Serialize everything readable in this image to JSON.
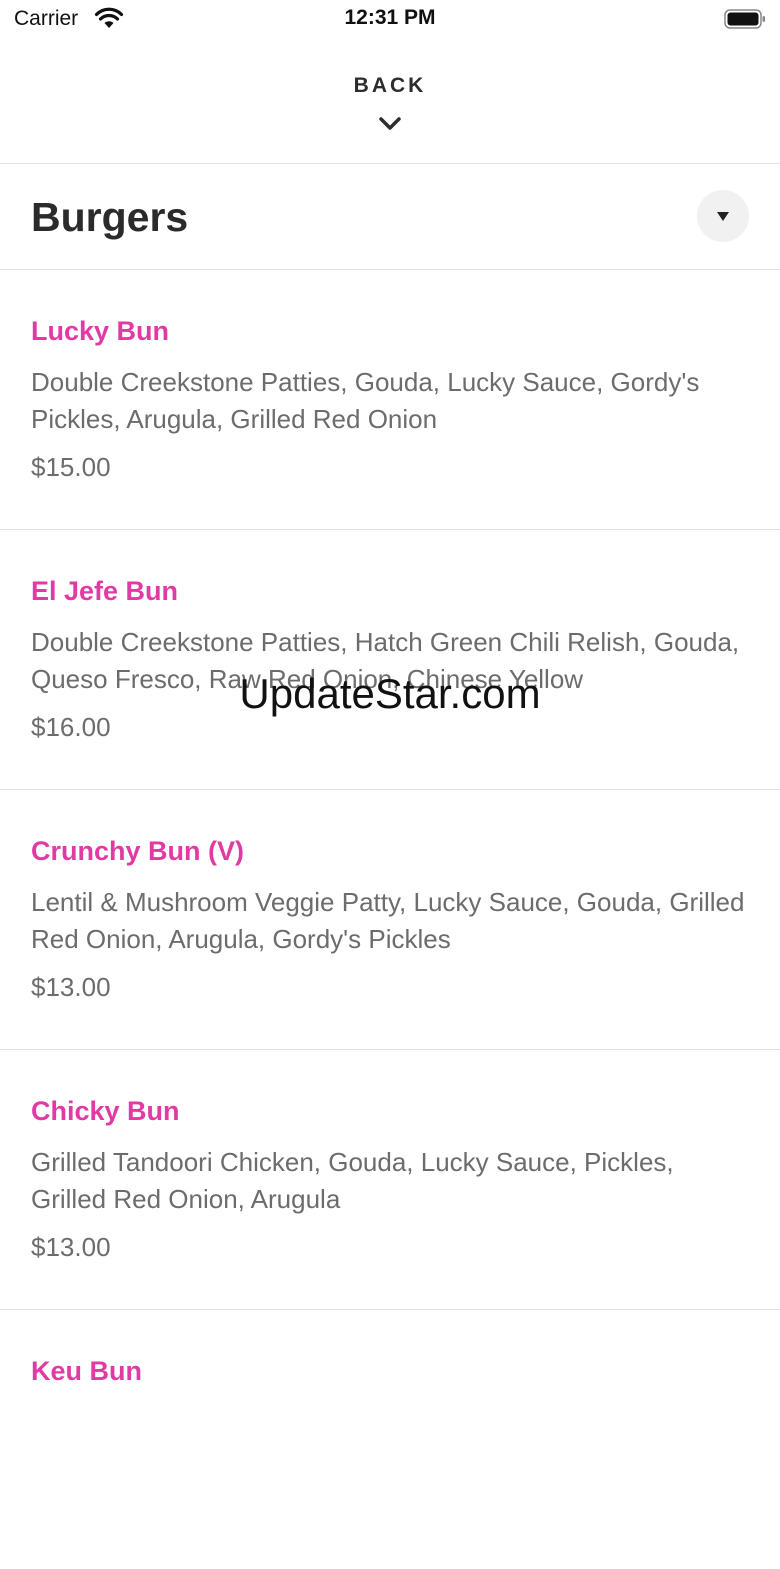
{
  "status_bar": {
    "carrier": "Carrier",
    "time": "12:31 PM"
  },
  "nav": {
    "back_label": "BACK"
  },
  "section": {
    "title": "Burgers"
  },
  "items": [
    {
      "name": "Lucky Bun",
      "description": "Double Creekstone Patties, Gouda, Lucky Sauce, Gordy's Pickles, Arugula, Grilled Red Onion",
      "price": "$15.00"
    },
    {
      "name": "El Jefe Bun",
      "description": "Double Creekstone Patties, Hatch Green Chili Relish, Gouda, Queso Fresco, Raw Red Onion, Chinese Yellow",
      "price": "$16.00"
    },
    {
      "name": "Crunchy Bun (V)",
      "description": "Lentil & Mushroom Veggie Patty, Lucky Sauce, Gouda, Grilled Red Onion, Arugula, Gordy's Pickles",
      "price": "$13.00"
    },
    {
      "name": "Chicky Bun",
      "description": "Grilled Tandoori Chicken, Gouda, Lucky Sauce, Pickles, Grilled Red Onion, Arugula",
      "price": "$13.00"
    },
    {
      "name": "Keu Bun",
      "description": "",
      "price": ""
    }
  ],
  "watermark": "UpdateStar.com",
  "colors": {
    "accent": "#e23aa4",
    "text_muted": "#6c6c6c",
    "divider": "#e2e2e2"
  }
}
